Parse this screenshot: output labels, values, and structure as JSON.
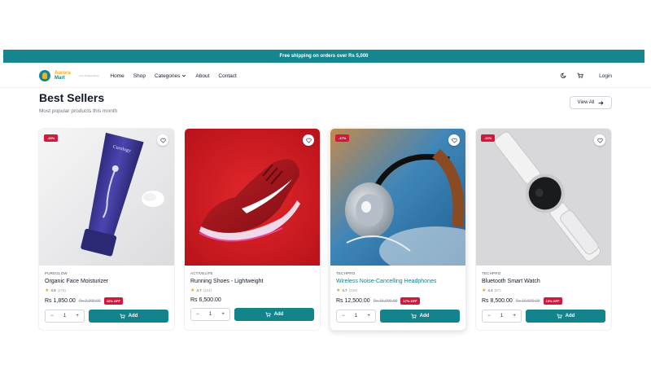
{
  "promo": {
    "text": "Free shipping on orders over Rs 5,000"
  },
  "brand": {
    "name_line1": "Aurora",
    "name_line2": "Mart",
    "tagline": "Your Trusted Shop"
  },
  "nav": [
    {
      "label": "Home"
    },
    {
      "label": "Shop"
    },
    {
      "label": "Categories"
    },
    {
      "label": "About"
    },
    {
      "label": "Contact"
    }
  ],
  "header": {
    "login_label": "Login"
  },
  "section": {
    "title": "Best Sellers",
    "subtitle": "Most popular products this month",
    "view_all_label": "View All"
  },
  "products": [
    {
      "brand": "PUREGLOW",
      "name": "Organic Face Moisturizer",
      "rating": "4.9",
      "reviews": "(176)",
      "price": "Rs 1,850.00",
      "old_price": "Rs 2,200.00",
      "discount_badge": "-16%",
      "off_label": "16% OFF",
      "qty": "1",
      "add_label": "Add",
      "name_highlight": false
    },
    {
      "brand": "ACTIVELIFE",
      "name": "Running Shoes - Lightweight",
      "rating": "4.7",
      "reviews": "(124)",
      "price": "Rs 6,500.00",
      "old_price": "",
      "discount_badge": "",
      "off_label": "",
      "qty": "1",
      "add_label": "Add",
      "name_highlight": false
    },
    {
      "brand": "TECHPRO",
      "name": "Wireless Noise-Cancelling Headphones",
      "rating": "4.7",
      "reviews": "(128)",
      "price": "Rs 12,500.00",
      "old_price": "Rs 15,000.00",
      "discount_badge": "-17%",
      "off_label": "17% OFF",
      "qty": "1",
      "add_label": "Add",
      "name_highlight": true
    },
    {
      "brand": "TECHPRO",
      "name": "Bluetooth Smart Watch",
      "rating": "4.4",
      "reviews": "(87)",
      "price": "Rs 8,500.00",
      "old_price": "Rs 10,500.00",
      "discount_badge": "-19%",
      "off_label": "19% OFF",
      "qty": "1",
      "add_label": "Add",
      "name_highlight": false
    }
  ],
  "colors": {
    "accent": "#15868f",
    "sale": "#d4173a",
    "star": "#f4a10b",
    "logo_gold": "#f2a60c"
  },
  "icons": {
    "theme_toggle": "moon-icon",
    "cart": "cart-icon",
    "wishlist": "heart-icon",
    "view_all": "arrow-right-icon"
  }
}
